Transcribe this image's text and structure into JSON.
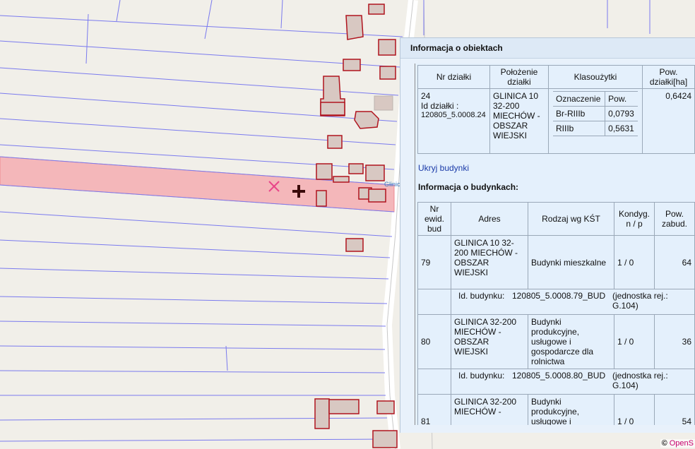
{
  "panel": {
    "title": "Informacja o obiektach"
  },
  "parcel_table": {
    "headers": [
      "Nr działki",
      "Położenie działki",
      "Klasoużytki",
      "Pow. działki[ha]"
    ],
    "row": {
      "nr": "24",
      "id_label": "Id działki :",
      "id": "120805_5.0008.24",
      "location": "GLINICA 10 32-200 MIECHÓW - OBSZAR WIEJSKI",
      "area": "0,6424",
      "classes_headers": [
        "Oznaczenie",
        "Pow."
      ],
      "classes": [
        {
          "code": "Br-RIIIb",
          "area": "0,0793"
        },
        {
          "code": "RIIIb",
          "area": "0,5631"
        }
      ]
    }
  },
  "toggle_link": "Ukryj budynki",
  "buildings_heading": "Informacja o budynkach:",
  "buildings_table": {
    "headers": [
      "Nr ewid. bud",
      "Adres",
      "Rodzaj wg KŚT",
      "Kondyg. n / p",
      "Pow. zabud."
    ],
    "rows": [
      {
        "nr": "79",
        "address": "GLINICA 10 32-200 MIECHÓW - OBSZAR WIEJSKI",
        "type": "Budynki mieszkalne",
        "floors": "1 / 0",
        "area": "64",
        "id_label": "Id. budynku:",
        "id": "120805_5.0008.79_BUD",
        "unit": "(jednostka rej.: G.104)"
      },
      {
        "nr": "80",
        "address": "GLINICA 32-200 MIECHÓW - OBSZAR WIEJSKI",
        "type": "Budynki produkcyjne, usługowe i gospodarcze dla rolnictwa",
        "floors": "1 / 0",
        "area": "36",
        "id_label": "Id. budynku:",
        "id": "120805_5.0008.80_BUD",
        "unit": "(jednostka rej.: G.104)"
      },
      {
        "nr": "81",
        "address": "GLINICA 32-200 MIECHÓW -",
        "type": "Budynki produkcyjne, usługowe i",
        "floors": "1 / 0",
        "area": "54"
      }
    ]
  },
  "map": {
    "label_glinica": "Glinic",
    "attribution_symbol": "©",
    "attribution_text": "OpenS",
    "colors": {
      "parcel_line": "#7a7aee",
      "highlight": "#f2a9ad",
      "building_fill": "#d8c8c2",
      "building_border": "#b0141e",
      "marker_x": "#e8458a"
    }
  }
}
